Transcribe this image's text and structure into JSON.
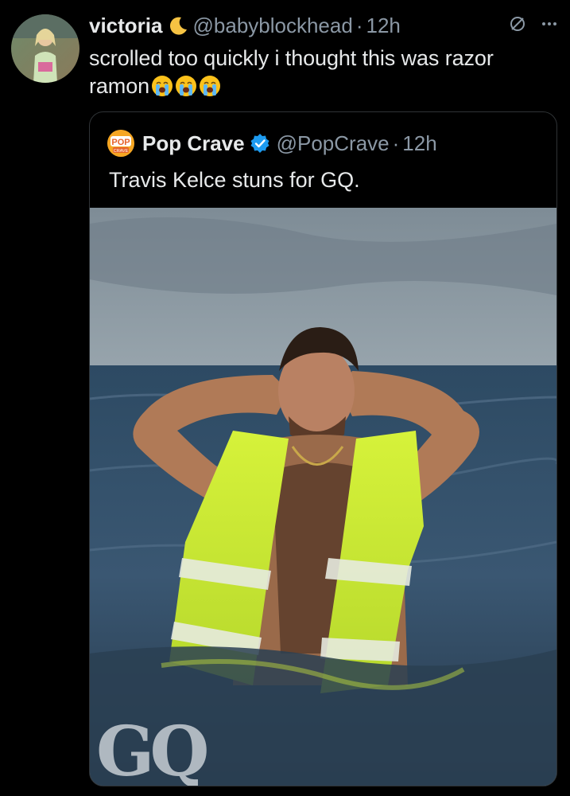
{
  "tweet": {
    "display_name": "victoria",
    "moon_icon": "crescent-moon-emoji",
    "handle": "@babyblockhead",
    "separator": "·",
    "time": "12h",
    "body": "scrolled too quickly i thought this was razor ramon",
    "emoji": [
      "loudly-crying-face",
      "loudly-crying-face",
      "loudly-crying-face"
    ]
  },
  "quote": {
    "avatar_text": "POP",
    "avatar_subtext": "CRAVE",
    "display_name": "Pop Crave",
    "verified": true,
    "handle": "@PopCrave",
    "separator": "·",
    "time": "12h",
    "text": "Travis Kelce stuns for GQ.",
    "photo_watermark": "GQ"
  },
  "colors": {
    "background": "#000000",
    "text": "#e7e9ea",
    "secondary": "#8b98a5",
    "verified": "#1d9bf0",
    "border": "#2f3336"
  }
}
